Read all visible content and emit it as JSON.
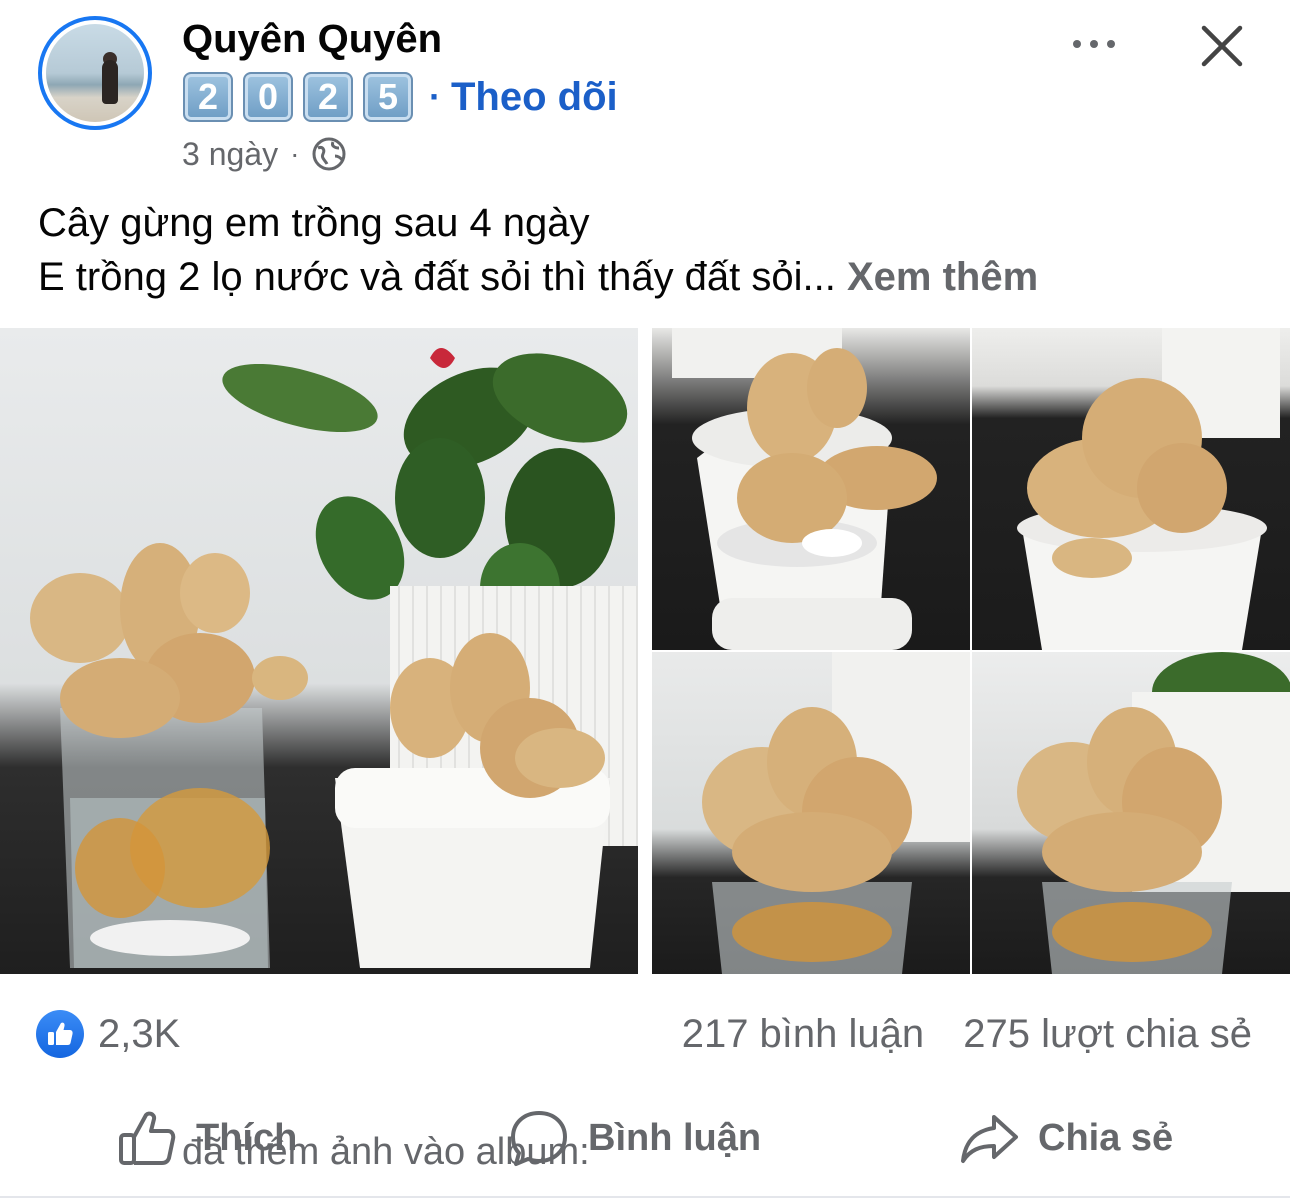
{
  "post": {
    "author": "Quyên Quyên",
    "action": "đã thêm ảnh vào album:",
    "album_digits": [
      "2",
      "0",
      "2",
      "5"
    ],
    "follow_label": "Theo dõi",
    "follow_separator": "·",
    "time": "3 ngày",
    "meta_separator": "·",
    "privacy_icon": "globe-icon",
    "caption_line1": "Cây gừng  em trồng sau 4 ngày",
    "caption_line2": "E trồng 2 lọ nước và đất sỏi thì thấy đất sỏi...",
    "see_more": "Xem thêm",
    "photos": [
      {
        "subject": "ginger in glass jar and white pot"
      },
      {
        "subject": "ginger in white pot top left"
      },
      {
        "subject": "ginger in white pot top right"
      },
      {
        "subject": "ginger in glass jar bottom left"
      },
      {
        "subject": "ginger in glass jar bottom right"
      }
    ]
  },
  "stats": {
    "reactions": "2,3K",
    "comments": "217 bình luận",
    "shares": "275 lượt chia sẻ"
  },
  "actions": {
    "like": "Thích",
    "comment": "Bình luận",
    "share": "Chia sẻ"
  },
  "icons": {
    "more": "more-options-icon",
    "close": "close-icon",
    "like_badge": "thumbs-up-icon",
    "like_action": "thumbs-up-outline-icon",
    "comment_action": "comment-bubble-icon",
    "share_action": "share-arrow-icon"
  },
  "colors": {
    "accent": "#1877f2",
    "link": "#1b5fc8",
    "secondary_text": "#65676b"
  }
}
